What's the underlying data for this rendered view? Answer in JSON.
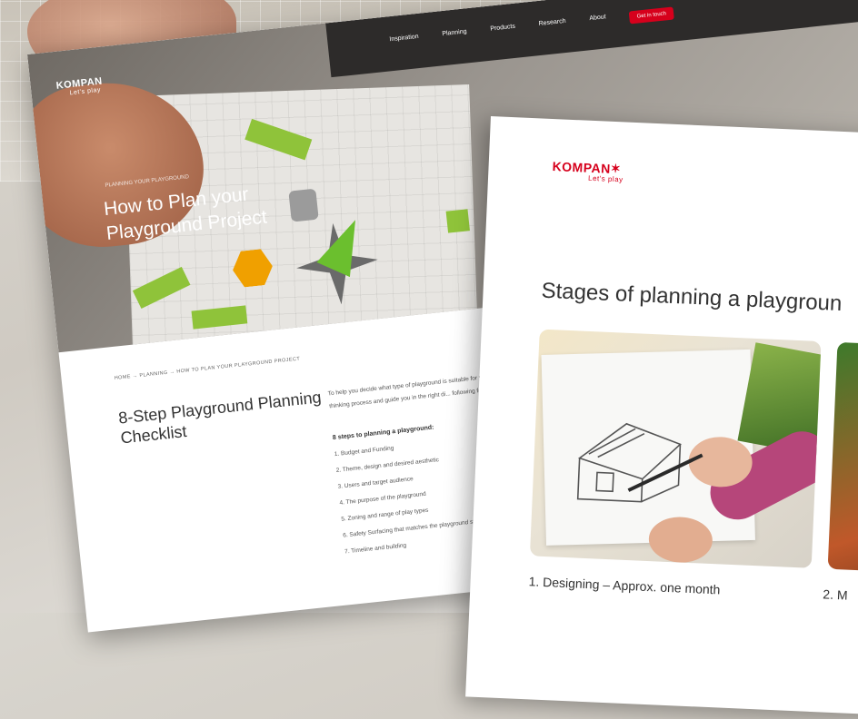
{
  "back_page": {
    "logo": {
      "name": "KOMPAN",
      "tagline": "Let's play"
    },
    "nav": [
      "Inspiration",
      "Planning",
      "Products",
      "Research",
      "About"
    ],
    "nav_cta": "Get in touch",
    "hero_breadcrumb": "PLANNING YOUR PLAYGROUND",
    "hero_title": "How to Plan your Playground Project",
    "breadcrumb": "HOME → PLANNING → HOW TO PLAN YOUR PLAYGROUND PROJECT",
    "section_title": "8-Step Playground Planning Checklist",
    "intro": "To help you decide what type of playground is suitable for your... will prompt your thinking process and guide you in the right di... following factors below.",
    "steps_heading": "8 steps to planning a playground:",
    "steps": [
      "1. Budget and Funding",
      "2. Theme, design and desired aesthetic",
      "3. Users and target audience",
      "4. The purpose of the playground",
      "5. Zoning and range of play types",
      "6. Safety Surfacing that matches the playground style",
      "7. Timeline and building"
    ]
  },
  "front_page": {
    "logo": {
      "name": "KOMPAN",
      "tagline": "Let's play"
    },
    "section_title": "Stages of planning a playgroun",
    "stages": [
      {
        "caption": "1. Designing – Approx. one month"
      },
      {
        "caption": "2. M"
      }
    ]
  },
  "colors": {
    "brand_red": "#d6001c",
    "green": "#8fc33a",
    "orange": "#f0a000"
  }
}
